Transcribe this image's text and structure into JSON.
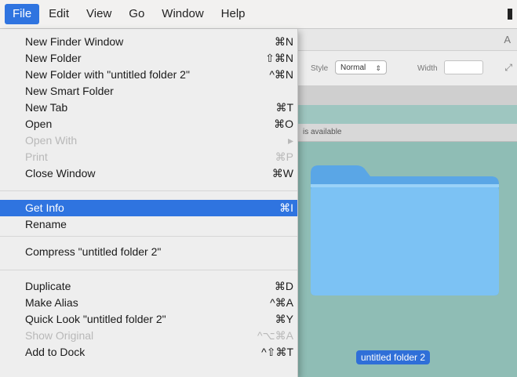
{
  "menubar": {
    "items": [
      "File",
      "Edit",
      "View",
      "Go",
      "Window",
      "Help"
    ]
  },
  "menu": {
    "items": [
      {
        "label": "New Finder Window",
        "shortcut": "⌘N"
      },
      {
        "label": "New Folder",
        "shortcut": "⇧⌘N"
      },
      {
        "label": "New Folder with \"untitled folder 2\"",
        "shortcut": "^⌘N"
      },
      {
        "label": "New Smart Folder",
        "shortcut": ""
      },
      {
        "label": "New Tab",
        "shortcut": "⌘T"
      },
      {
        "label": "Open",
        "shortcut": "⌘O"
      },
      {
        "label": "Open With",
        "shortcut": "▸"
      },
      {
        "label": "Print",
        "shortcut": "⌘P"
      },
      {
        "label": "Close Window",
        "shortcut": "⌘W"
      },
      {
        "label": "Get Info",
        "shortcut": "⌘I"
      },
      {
        "label": "Rename",
        "shortcut": ""
      },
      {
        "label": "Compress \"untitled folder 2\"",
        "shortcut": ""
      },
      {
        "label": "Duplicate",
        "shortcut": "⌘D"
      },
      {
        "label": "Make Alias",
        "shortcut": "^⌘A"
      },
      {
        "label": "Quick Look \"untitled folder 2\"",
        "shortcut": "⌘Y"
      },
      {
        "label": "Show Original",
        "shortcut": "^⌥⌘A"
      },
      {
        "label": "Add to Dock",
        "shortcut": "^⇧⌘T"
      }
    ]
  },
  "finder": {
    "toolbar": {
      "style_label": "Style",
      "style_value": "Normal",
      "width_label": "Width"
    },
    "status_text": "is available",
    "folder_name": "untitled folder 2"
  },
  "colors": {
    "highlight": "#2f74e0",
    "folder_blue": "#74baf0"
  }
}
